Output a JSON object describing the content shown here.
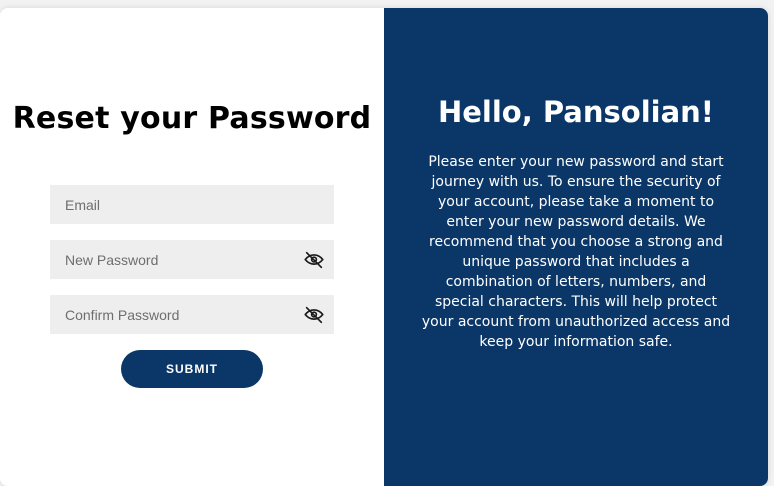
{
  "form": {
    "title": "Reset your Password",
    "email_placeholder": "Email",
    "new_password_placeholder": "New Password",
    "confirm_password_placeholder": "Confirm Password",
    "submit_label": "SUBMIT"
  },
  "panel": {
    "heading": "Hello, Pansolian!",
    "description": "Please enter your new password and start journey with us. To ensure the security of your account, please take a moment to enter your new password details. We recommend that you choose a strong and unique password that includes a combination of letters, numbers, and special characters. This will help protect your account from unauthorized access and keep your information safe."
  },
  "icons": {
    "new_password_toggle": "eye-slash-icon",
    "confirm_password_toggle": "eye-slash-icon"
  },
  "colors": {
    "brand_navy": "#0b3768",
    "field_bg": "#eeeeee",
    "page_bg": "#f2f2f2"
  }
}
